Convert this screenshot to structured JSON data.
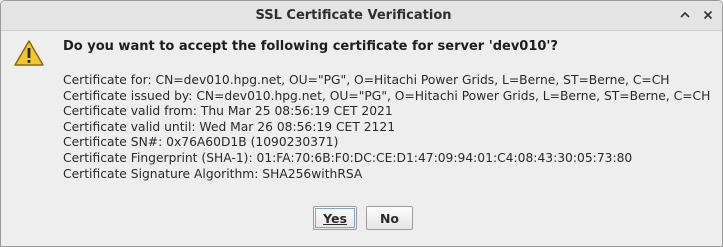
{
  "window": {
    "title": "SSL Certificate Verification",
    "controls": [
      "chevron-up-icon",
      "close-icon"
    ]
  },
  "dialog": {
    "icon": "warning-icon",
    "question": "Do you want to accept the following certificate for server 'dev010'?",
    "details": [
      "Certificate for: CN=dev010.hpg.net, OU=\"PG\", O=Hitachi Power Grids, L=Berne, ST=Berne, C=CH",
      "Certificate issued by: CN=dev010.hpg.net, OU=\"PG\", O=Hitachi Power Grids, L=Berne, ST=Berne, C=CH",
      "Certificate valid from: Thu Mar 25 08:56:19 CET 2021",
      "Certificate valid until: Wed Mar 26 08:56:19 CET 2121",
      "Certificate SN#: 0x76A60D1B (1090230371)",
      "Certificate Fingerprint (SHA-1): 01:FA:70:6B:F0:DC:CE:D1:47:09:94:01:C4:08:43:30:05:73:80",
      "Certificate Signature Algorithm: SHA256withRSA"
    ]
  },
  "buttons": {
    "yes": "Yes",
    "no": "No"
  },
  "colors": {
    "warning_fill": "#f2c531",
    "warning_outline": "#8a6d00",
    "focus_ring": "#7fa6d8"
  }
}
